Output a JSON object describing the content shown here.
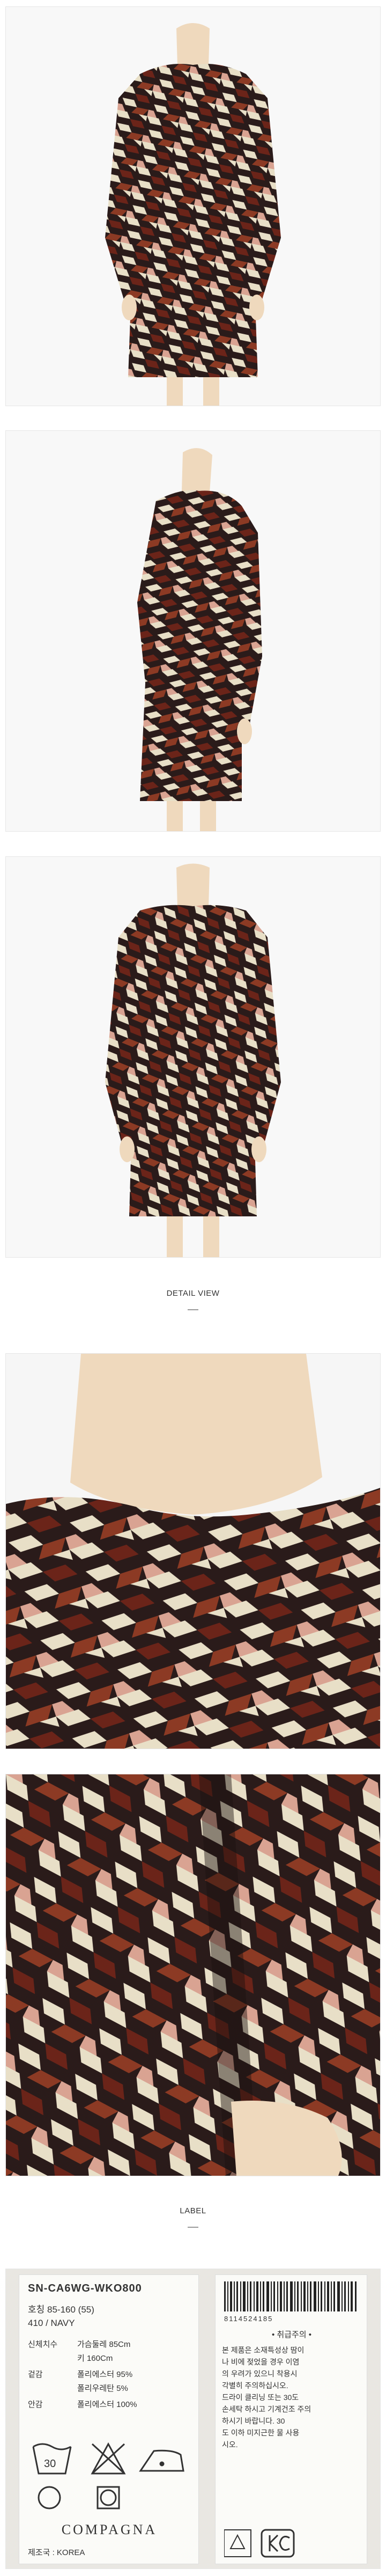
{
  "sections": {
    "detail_view": "DETAIL VIEW",
    "label": "LABEL"
  },
  "colors": {
    "pattern_dark": "#2a1b1a",
    "pattern_brown": "#6b2419",
    "pattern_rust": "#8c3a24",
    "pattern_cream": "#e8dfc7",
    "pattern_pink": "#d9a392",
    "skin": "#efd9bd"
  },
  "label_left": {
    "code": "SN-CA6WG-WKO800",
    "size_row": "호칭  85-160 (55)",
    "color_row": "410 / NAVY",
    "rows": [
      {
        "k": "신체치수",
        "v": "가슴둘레   85Cm"
      },
      {
        "k": "",
        "v": "키              160Cm"
      },
      {
        "k": "겉감",
        "v": "폴리에스터  95%"
      },
      {
        "k": "",
        "v": "폴리우레탄   5%"
      },
      {
        "k": "안감",
        "v": "폴리에스터 100%"
      }
    ],
    "brand": "COMPAGNA",
    "origin": "제조국 : KOREA"
  },
  "label_right": {
    "barcode_number": "8114524185",
    "heading": "• 취급주의 •",
    "lines": [
      "본 제품은 소재특성상 땀이",
      "나 비에 젖었을 경우 이염",
      "의 우려가 있으니 착용시",
      "각별히 주의하십시오.",
      "드라이 클리닝 또는 30도",
      "손세탁 하시고 기계건조 주의",
      "하시기 바랍니다. 30",
      "도 이하 미지근한 물 사용",
      "시오."
    ]
  }
}
